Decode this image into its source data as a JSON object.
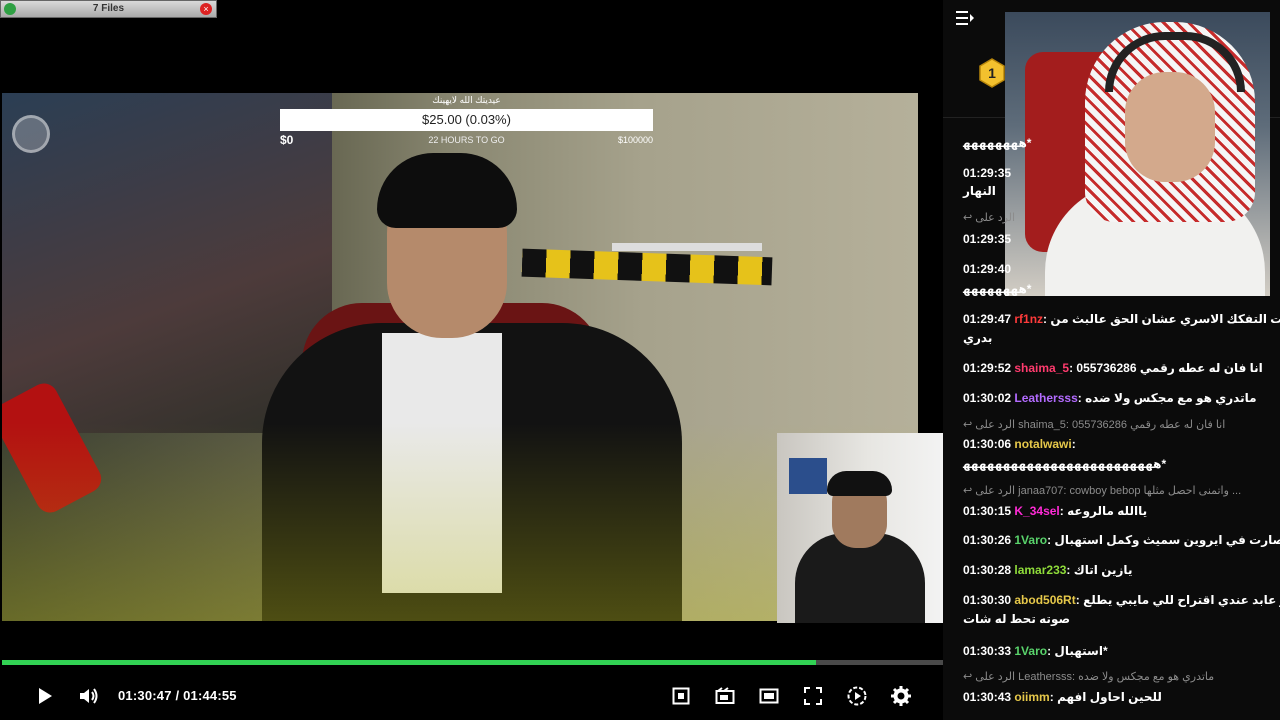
{
  "files_widget": {
    "label": "7 Files"
  },
  "goal": {
    "title": "عيديتك الله لايهينك",
    "amount": "$25.00 (0.03%)",
    "min": "$0",
    "remaining": "22 HOURS TO GO",
    "max": "$100000"
  },
  "player": {
    "current_time": "01:30:47",
    "separator": " / ",
    "duration": "01:44:55",
    "progress_fraction": 0.8655
  },
  "icons": {
    "play": "play-icon",
    "volume": "volume-icon",
    "pip": "picture-in-picture-icon",
    "theater": "theater-mode-icon",
    "mini": "mini-player-icon",
    "fullscreen": "fullscreen-icon",
    "speed": "playback-speed-icon",
    "settings": "gear-icon",
    "collapse": "collapse-chat-icon",
    "badge": "subscriber-badge-icon"
  },
  "chat": {
    "badge_number": "1",
    "lines": [
      {
        "kind": "cont",
        "text": "ﻫﻬﻬﻬﻬﻬﻬﻬ*"
      },
      {
        "kind": "msg",
        "ts": "01:29:35",
        "user": "",
        "color": "#ffffff",
        "text": ""
      },
      {
        "kind": "cont",
        "text": "النهار"
      },
      {
        "kind": "reply",
        "text": "الرد على"
      },
      {
        "kind": "msg",
        "ts": "01:29:35",
        "user": "",
        "color": "#ffffff",
        "text": ""
      },
      {
        "kind": "msg",
        "ts": "01:29:40",
        "user": "",
        "color": "#ffffff",
        "text": ""
      },
      {
        "kind": "cont",
        "text": "ﻫﻬﻬﻬﻬﻬﻬﻬ*"
      },
      {
        "kind": "msg",
        "ts": "01:29:47",
        "user": "rf1nz",
        "color": "#ff3b3b",
        "text": "تمنيت التفكك الاسري عشان الحق عالبث من"
      },
      {
        "kind": "cont",
        "text": "بدري"
      },
      {
        "kind": "msg",
        "ts": "01:29:52",
        "user": "shaima_5",
        "color": "#ff3b6e",
        "text": "انا فان له عطه رقمي 055736286"
      },
      {
        "kind": "msg",
        "ts": "01:30:02",
        "user": "Leathersss",
        "color": "#b36bff",
        "text": "ماتدري هو مع مجكس ولا ضده"
      },
      {
        "kind": "reply",
        "text": "الرد على shaima_5: انا فان له عطه رقمي 055736286"
      },
      {
        "kind": "msg",
        "ts": "01:30:06",
        "user": "notalwawi",
        "color": "#e6c84a",
        "text": ""
      },
      {
        "kind": "cont",
        "text": "ﻫﻬﻬﻬﻬﻬﻬﻬﻬﻬﻬﻬﻬﻬﻬﻬﻬﻬﻬﻬﻬﻬﻬﻬﻬ*"
      },
      {
        "kind": "reply",
        "text": "الرد على janaa707: cowboy bebop واتمنى احصل مثلها ..."
      },
      {
        "kind": "msg",
        "ts": "01:30:15",
        "user": "K_34sel",
        "color": "#ff2bd6",
        "text": "ياالله مالروعه"
      },
      {
        "kind": "msg",
        "ts": "01:30:26",
        "user": "1Varo",
        "color": "#59d36b",
        "text": "قد صارت في ايروين سميث وكمل استهبال"
      },
      {
        "kind": "msg",
        "ts": "01:30:28",
        "user": "lamar233",
        "color": "#8fdc3a",
        "text": "يازين اتاك"
      },
      {
        "kind": "msg",
        "ts": "01:30:30",
        "user": "abod506Rt",
        "color": "#e6c84a",
        "text": "ابو عابد عندي اقتراح للي مايبي يطلع"
      },
      {
        "kind": "cont",
        "text": "صوته تحط له شات"
      },
      {
        "kind": "msg",
        "ts": "01:30:33",
        "user": "1Varo",
        "color": "#59d36b",
        "text": "استهبال*"
      },
      {
        "kind": "reply",
        "text": "الرد على Leathersss: ماتدري هو مع مجكس ولا ضده"
      },
      {
        "kind": "msg",
        "ts": "01:30:43",
        "user": "oiimm",
        "color": "#e6c84a",
        "text": "للحين احاول افهم"
      }
    ]
  },
  "colors": {
    "progress": "#32d254",
    "track": "#4a4a4a",
    "chat_bg": "#0b0b0b"
  }
}
